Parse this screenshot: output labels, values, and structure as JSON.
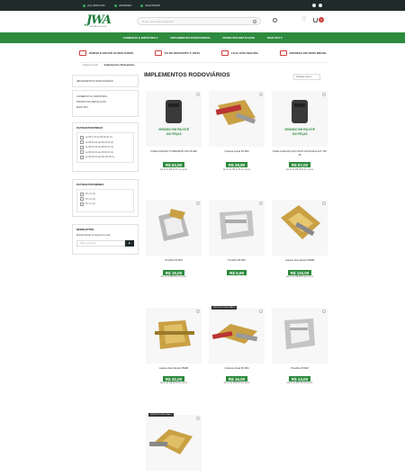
{
  "topbar": {
    "phone": "(11) 2945-0111",
    "brand": "JWARDEX",
    "whatsapp": "WHATSAPP",
    "social": [
      "facebook-icon",
      "instagram-icon"
    ]
  },
  "header": {
    "logo_text": "JWA",
    "logo_tagline": "PRESSÃO DE MOLA",
    "search_placeholder": "O que você está buscando?",
    "cart_count": "0"
  },
  "nav": {
    "items": [
      "COMÉRCIO & INDÚSTRIA ▾",
      "IMPLEMENTOS RODOVIÁRIOS",
      "PRODUTOS METÁLICOS",
      "MAIS PET ▾"
    ]
  },
  "benefits": [
    "PARCELE EM ATÉ 3X SEM JUROS",
    "5% DE DESCONTO À VISTA",
    "LOJA 100% SEGURA",
    "ENTREGA EM TODO BRASIL"
  ],
  "breadcrumb": {
    "home": "Página Inicial",
    "sep": "›",
    "current": "Implementos Rodoviários"
  },
  "sidebar": {
    "current_category": "IMPLEMENTOS RODOVIÁRIOS",
    "categories": [
      "COMÉRCIO E INDÚSTRIA",
      "PRODUTOS METÁLICOS",
      "MAIS PET"
    ],
    "price_filter_title": "FILTRAR POR PREÇO",
    "price_options": [
      "de R$ 1,00 até R$ 20,00 (4)",
      "de R$ 20,00 até R$ 40,00 (3)",
      "de R$ 40,00 até R$ 60,00 (2)",
      "de R$ 60,00 até R$ 80,00 (1)",
      "de R$ 80,00 até R$ 120,00 (1)"
    ],
    "size_filter_title": "FILTRAR POR MEDIDA",
    "size_options": [
      "25 mm (4)",
      "35 mm (5)",
      "50 mm (2)"
    ],
    "newsletter_title": "NEWSLETTER",
    "newsletter_text": "Receba ofertas incríveis por e-mail",
    "newsletter_placeholder": "Digite seu email",
    "newsletter_btn": "►"
  },
  "main": {
    "title": "IMPLEMENTOS RODOVIÁRIOS",
    "sort_label": "Ordenar itens ▾"
  },
  "products": [
    {
      "name": "FIVELA FECHO TORRADOR 150 25 MM",
      "price": "R$ 62,90",
      "install": "até 3x de R$ 20,97 sem juros",
      "ribbon": ""
    },
    {
      "name": "Catraca Anual 35 MM",
      "price": "R$ 29,90",
      "install": "até 2x de R$ 14,95 sem juros",
      "ribbon": ""
    },
    {
      "name": "FIVELA FECHO AÇO INOX AJUSTADA ALT 187 35",
      "price": "R$ 57,00",
      "install": "até 2x de R$ 28,50 sem juros",
      "ribbon": ""
    },
    {
      "name": "Presilha 50 MM",
      "price": "R$ 16,00",
      "install": "até 2x de R$ 8,00 sem juros",
      "ribbon": ""
    },
    {
      "name": "Presilha 35 MM",
      "price": "R$ 5,09",
      "install": "",
      "ribbon": ""
    },
    {
      "name": "catraca Fiat tubular 50MM",
      "price": "R$ 115,00",
      "install": "até 3x de R$ 38,33 sem juros",
      "ribbon": ""
    },
    {
      "name": "catraca Fiat tubular 35MM",
      "price": "R$ 32,00",
      "install": "até 2x de R$ 16,00 sem juros",
      "ribbon": ""
    },
    {
      "name": "Catraca Anual 50 MM",
      "price": "R$ 16,00",
      "install": "até 2x de R$ 8,00 sem juros",
      "ribbon": "PRODUTO ESGOTADO"
    },
    {
      "name": "Presilha 25 MM",
      "price": "R$ 14,00",
      "install": "até 2x de R$ 7,00 sem juros",
      "ribbon": ""
    },
    {
      "name": "",
      "price": "",
      "install": "",
      "ribbon": "PRODUTO ESGOTADO"
    }
  ]
}
